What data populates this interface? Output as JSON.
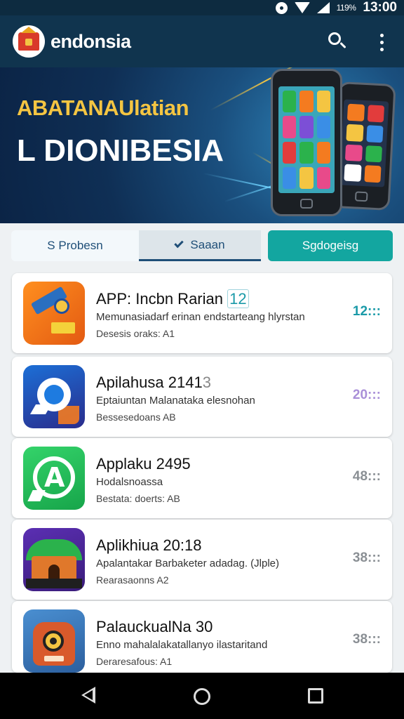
{
  "status_bar": {
    "battery": "119%",
    "time": "13:00"
  },
  "app_bar": {
    "title": "endonsia"
  },
  "banner": {
    "headline": "ABATANAUlatian",
    "subheadline": "L DIONIBESIA",
    "accent_color": "#f4c542"
  },
  "tabs": [
    {
      "label": "S Probesn"
    },
    {
      "label": "Saaan"
    },
    {
      "label": "Sgdogeisg"
    }
  ],
  "apps": [
    {
      "title": "APP: Incbn Rarian",
      "badge": "12",
      "desc": "Memunasiadarf erinan endstarteang hlyrstan",
      "meta": "Desesis oraks: A1",
      "count": "12:::"
    },
    {
      "title": "Apilahusa 2141",
      "badge": "3",
      "desc": "Eptaiuntan Malanataka elesnohan",
      "meta": "Bessesedoans AB",
      "count": "20:::"
    },
    {
      "title": "Applaku 2495",
      "badge": "",
      "desc": "Hodalsnoassa",
      "meta": "Bestata: doerts: AB",
      "count": "48:::"
    },
    {
      "title": "Aplikhiua 20:18",
      "badge": "",
      "desc": "Apalantakar Barbaketer adadag. (Jlple)",
      "meta": "Rearasaonns A2",
      "count": "38:::"
    },
    {
      "title": "PalauckualNa 30",
      "badge": "",
      "desc": "Enno mahalalakatallanyo ilastaritand",
      "meta": "Deraresafous: A1",
      "count": "38:::"
    }
  ],
  "colors": {
    "header": "#10344e",
    "accent_teal": "#13a6a0",
    "badge_teal": "#1a9aa8",
    "badge_purple": "#a98fd8"
  }
}
